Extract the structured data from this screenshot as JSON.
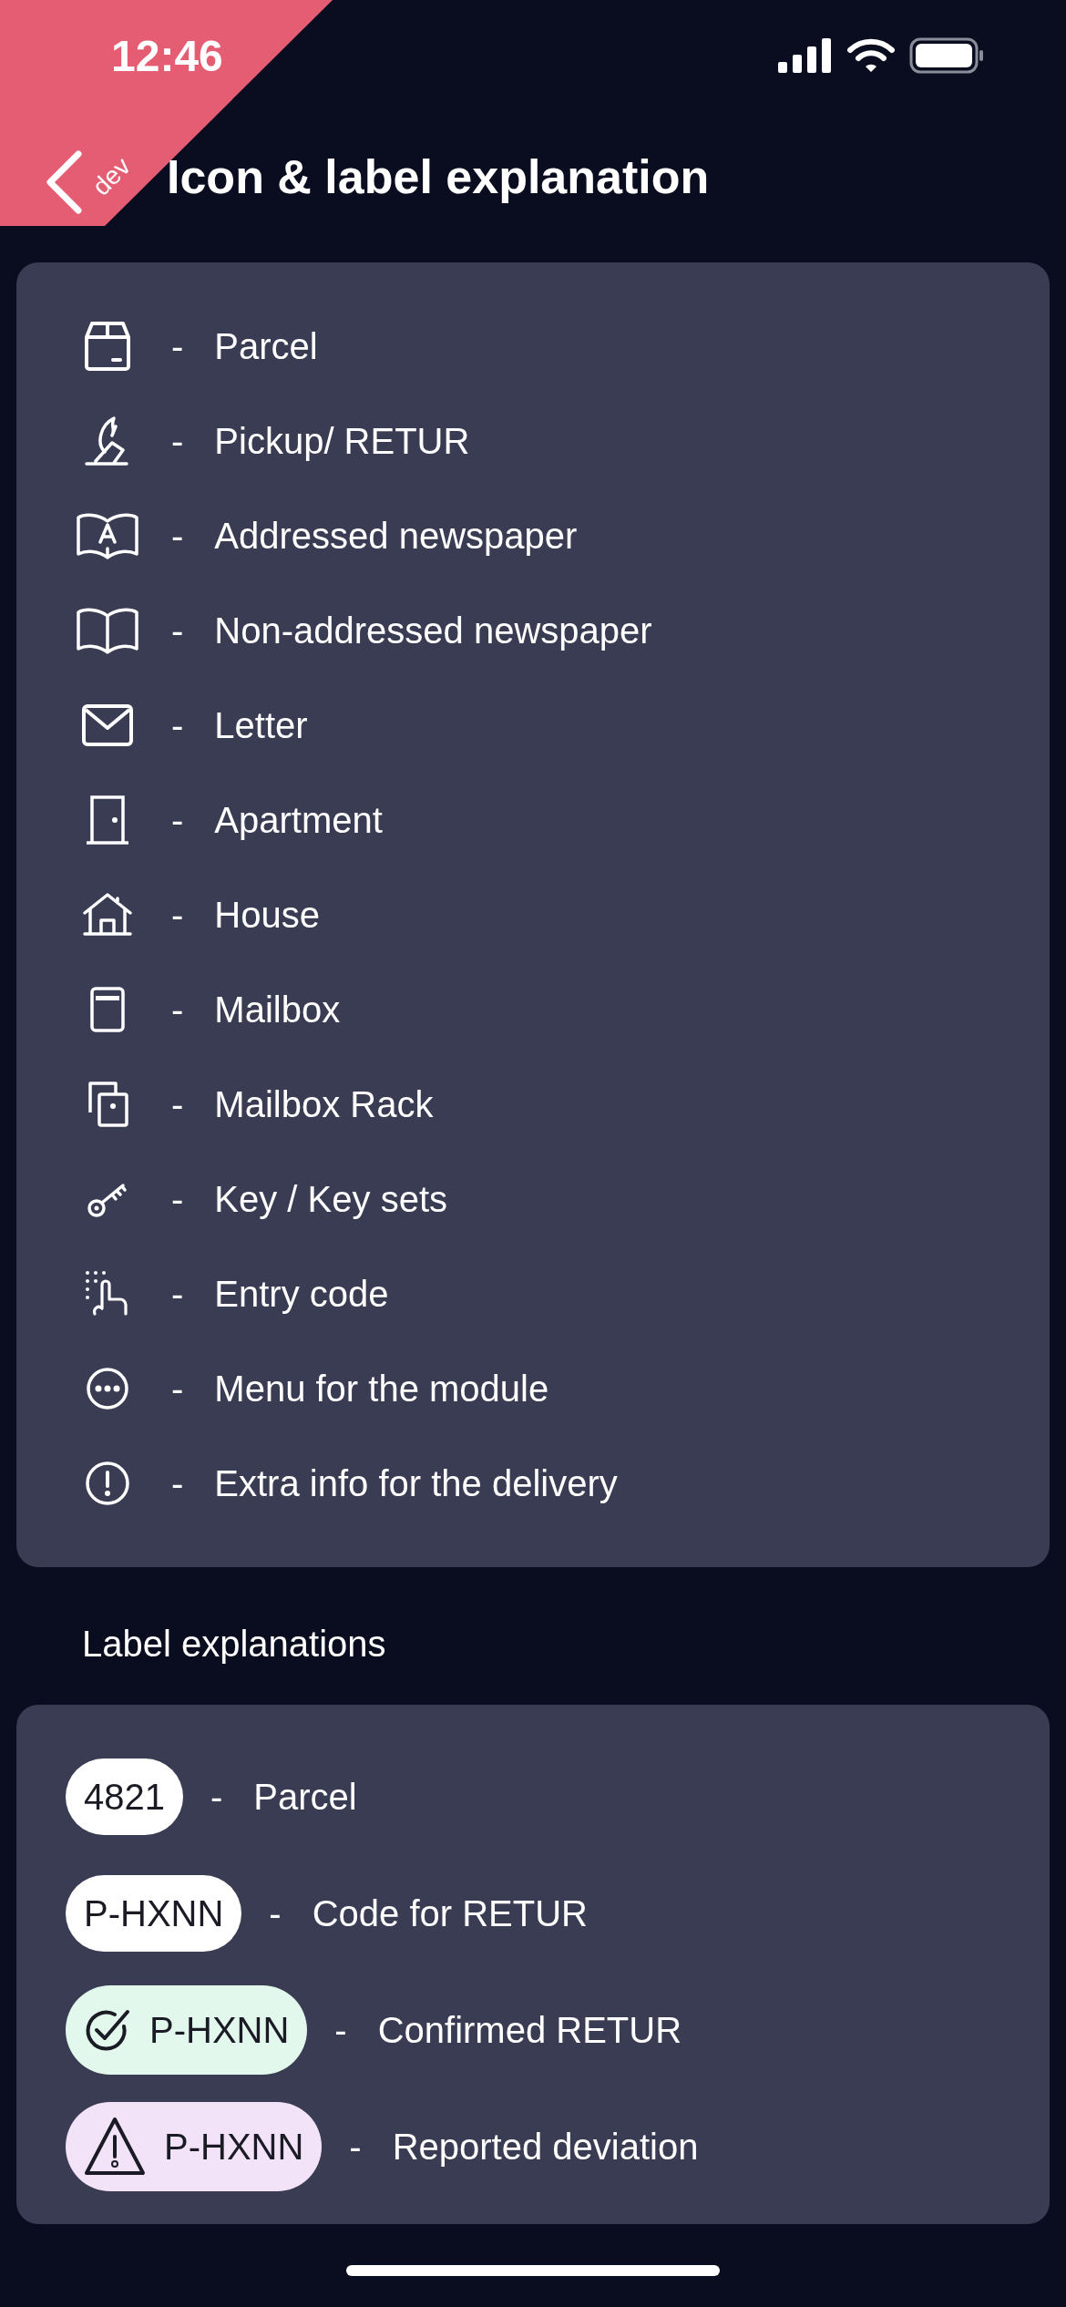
{
  "status_bar": {
    "time": "12:46"
  },
  "ribbon": {
    "label": "dev"
  },
  "header": {
    "title": "Icon & label explanation"
  },
  "icon_explanations": [
    {
      "kind": "parcel",
      "separator": "-",
      "label": "Parcel"
    },
    {
      "kind": "pickup",
      "separator": "-",
      "label": "Pickup/ RETUR"
    },
    {
      "kind": "addressed",
      "separator": "-",
      "label": "Addressed newspaper"
    },
    {
      "kind": "book",
      "separator": "-",
      "label": "Non-addressed newspaper"
    },
    {
      "kind": "letter",
      "separator": "-",
      "label": "Letter"
    },
    {
      "kind": "door",
      "separator": "-",
      "label": "Apartment"
    },
    {
      "kind": "house",
      "separator": "-",
      "label": "House"
    },
    {
      "kind": "mailbox",
      "separator": "-",
      "label": "Mailbox"
    },
    {
      "kind": "rack",
      "separator": "-",
      "label": "Mailbox Rack"
    },
    {
      "kind": "key",
      "separator": "-",
      "label": "Key / Key sets"
    },
    {
      "kind": "code",
      "separator": "-",
      "label": "Entry code"
    },
    {
      "kind": "menu",
      "separator": "-",
      "label": "Menu for the module"
    },
    {
      "kind": "info",
      "separator": "-",
      "label": "Extra info for the delivery"
    }
  ],
  "label_section_title": "Label explanations",
  "label_explanations": [
    {
      "kind": "plain",
      "tag": "4821",
      "separator": "-",
      "label": "Parcel"
    },
    {
      "kind": "plain",
      "tag": "P-HXNN",
      "separator": "-",
      "label": "Code for RETUR"
    },
    {
      "kind": "confirmed",
      "tag": "P-HXNN",
      "separator": "-",
      "label": "Confirmed RETUR"
    },
    {
      "kind": "deviation",
      "tag": "P-HXNN",
      "separator": "-",
      "label": "Reported deviation"
    }
  ]
}
